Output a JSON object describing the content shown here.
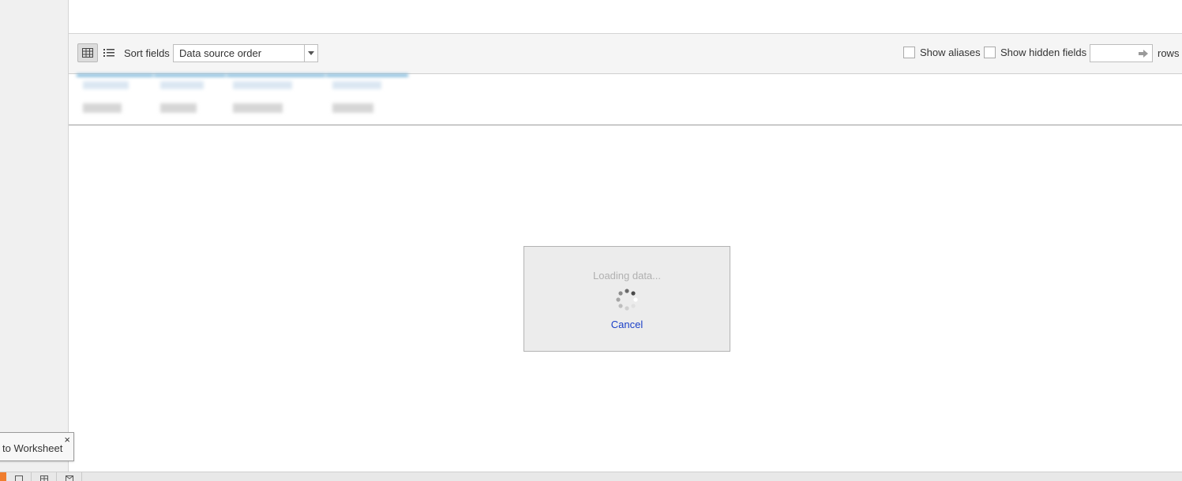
{
  "toolbar": {
    "grid_view_icon": "grid-icon",
    "list_view_icon": "list-icon",
    "sort_label": "Sort fields",
    "sort_value": "Data source order",
    "show_aliases_label": "Show aliases",
    "show_aliases_checked": false,
    "show_hidden_label": "Show hidden fields",
    "show_hidden_checked": false,
    "rows_value": "",
    "rows_label": "rows"
  },
  "loading": {
    "text": "Loading data...",
    "cancel_label": "Cancel"
  },
  "toast": {
    "text": "to Worksheet",
    "close_glyph": "×"
  },
  "bottom_bar": {
    "accent_color": "#f07d2e",
    "buttons": [
      "new-worksheet-icon",
      "new-dashboard-icon",
      "new-story-icon"
    ]
  },
  "colors": {
    "link": "#1a3fc7",
    "column_header_accent": "#5aa4d0"
  }
}
